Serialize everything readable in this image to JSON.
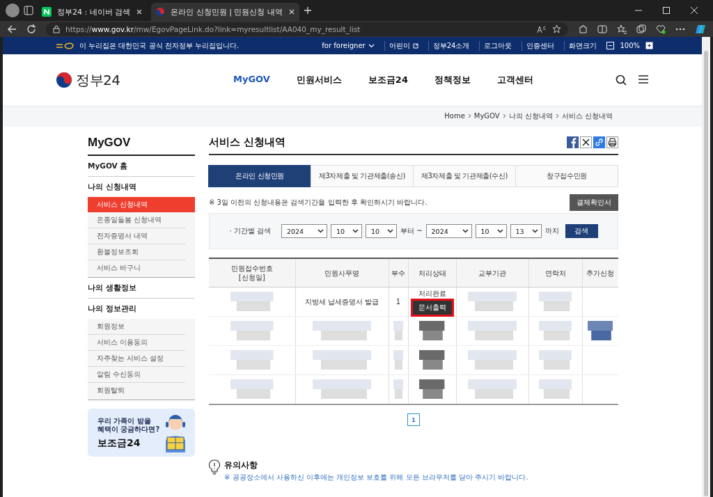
{
  "browser": {
    "tabs": [
      {
        "title": "정부24 : 네이버 검색",
        "selected": false
      },
      {
        "title": "온라인 신청민원 | 민원신청 내역",
        "selected": true
      }
    ],
    "address": {
      "prefix": "https://",
      "host": "www.gov.kr",
      "path": "/mw/EgovPageLink.do?link=myresultlist/AA040_my_result_list"
    }
  },
  "top_bar": {
    "notice": "이 누리집은 대한민국 공식 전자정부 누리집입니다.",
    "links": [
      "for foreigner",
      "어린이",
      "정부24소개",
      "로그아웃",
      "인증센터"
    ],
    "zoom_label": "화면크기",
    "zoom_value": "100%"
  },
  "header": {
    "logo": "정부24",
    "nav": [
      {
        "label": "MyGOV",
        "selected": true
      },
      {
        "label": "민원서비스",
        "selected": false
      },
      {
        "label": "보조금24",
        "selected": false
      },
      {
        "label": "정책정보",
        "selected": false
      },
      {
        "label": "고객센터",
        "selected": false
      }
    ]
  },
  "breadcrumb": [
    "Home",
    "MyGOV",
    "나의 신청내역",
    "서비스 신청내역"
  ],
  "sidebar": {
    "title": "MyGOV",
    "items": [
      {
        "label": "MyGOV 홈"
      },
      {
        "label": "나의 신청내역",
        "children": [
          {
            "label": "서비스 신청내역",
            "selected": true
          },
          {
            "label": "온종일돌봄 신청내역",
            "selected": false
          },
          {
            "label": "전자증명서 내역",
            "selected": false
          },
          {
            "label": "환불정보조회",
            "selected": false
          },
          {
            "label": "서비스 바구니",
            "selected": false
          }
        ]
      },
      {
        "label": "나의 생활정보"
      },
      {
        "label": "나의 정보관리",
        "children": [
          {
            "label": "회원정보",
            "selected": false
          },
          {
            "label": "서비스 이용동의",
            "selected": false
          },
          {
            "label": "자주찾는 서비스 설정",
            "selected": false
          },
          {
            "label": "알림 수신동의",
            "selected": false
          },
          {
            "label": "회원탈퇴",
            "selected": false
          }
        ]
      }
    ],
    "banner": {
      "lines": [
        "우리 가족이 받을",
        "혜택이 궁금하다면?"
      ],
      "title": "보조금24"
    }
  },
  "main": {
    "title": "서비스 신청내역",
    "tabs": [
      {
        "label": "온라인 신청민원",
        "selected": true
      },
      {
        "label": "제3자제출 및 기관제출(송신)",
        "selected": false
      },
      {
        "label": "제3자제출 및 기관제출(수신)",
        "selected": false
      },
      {
        "label": "창구접수민원",
        "selected": false
      }
    ],
    "notice": "※ 3일 이전의 신청내용은 검색기간을 입력한 후 확인하시기 바랍니다.",
    "receipt_button": "결제확인서",
    "search": {
      "label": "· 기간별 검색",
      "from": [
        "2024",
        "10",
        "10"
      ],
      "from_suffix": "부터 ~",
      "to": [
        "2024",
        "10",
        "13"
      ],
      "to_suffix": "까지",
      "button": "검색"
    },
    "table": {
      "columns": [
        {
          "label": "민원접수번호",
          "sublabel": "[신청일]"
        },
        {
          "label": "민원사무명"
        },
        {
          "label": "부수"
        },
        {
          "label": "처리상태"
        },
        {
          "label": "교부기관"
        },
        {
          "label": "연락처"
        },
        {
          "label": "추가신청"
        }
      ],
      "rows": [
        {
          "kind": "data",
          "cells": [
            {
              "kind": "redacted"
            },
            {
              "kind": "text",
              "text": "지방세 납세증명서 발급"
            },
            {
              "kind": "text",
              "text": "1"
            },
            {
              "kind": "status",
              "text": "처리완료",
              "button": "문서출력",
              "highlighted": true
            },
            {
              "kind": "redacted"
            },
            {
              "kind": "redacted"
            },
            {
              "kind": "empty"
            }
          ]
        },
        {
          "kind": "redacted"
        },
        {
          "kind": "redacted"
        },
        {
          "kind": "redacted"
        }
      ]
    },
    "pages": [
      {
        "label": "1",
        "selected": true
      }
    ],
    "caution": {
      "title": "유의사항",
      "text": "※ 공공장소에서 사용하신 이후에는 개인정보 보호를 위해 모든 브라우저를 닫아 주시기 바랍니다."
    }
  }
}
